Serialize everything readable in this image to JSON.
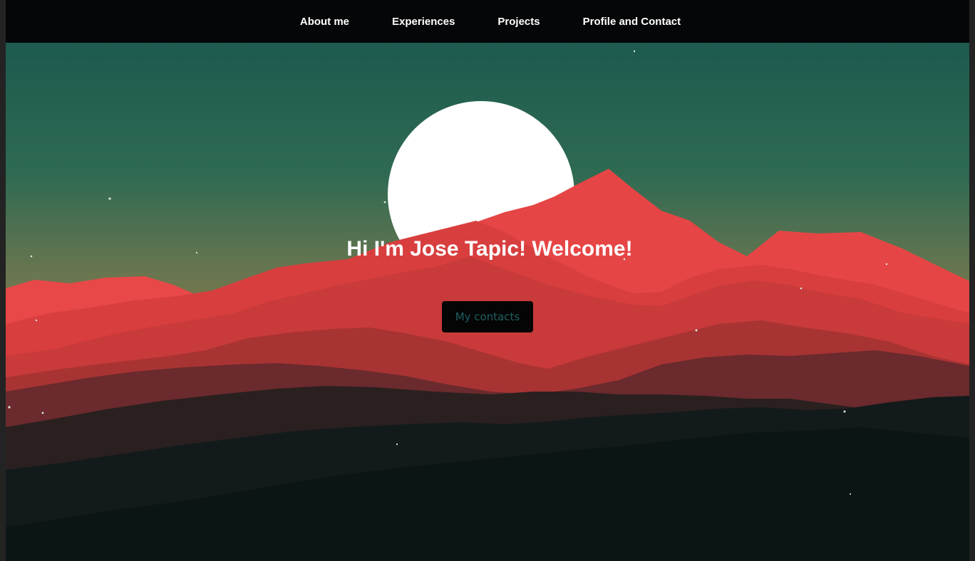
{
  "nav": {
    "items": [
      {
        "label": "About me"
      },
      {
        "label": "Experiences"
      },
      {
        "label": "Projects"
      },
      {
        "label": "Profile and Contact"
      }
    ]
  },
  "hero": {
    "greeting": "Hi I'm Jose Tapic! Welcome!",
    "cta_label": "My contacts",
    "background": "mountain-sunset-illustration"
  },
  "colors": {
    "nav_background": "#050607",
    "sky_top": "#1d5a4f",
    "sky_bottom": "#7a7a48",
    "mountain_red": "#e64545",
    "mountain_dark": "#0d1718",
    "cta_text": "#1f5f61",
    "cta_background": "#050505"
  }
}
